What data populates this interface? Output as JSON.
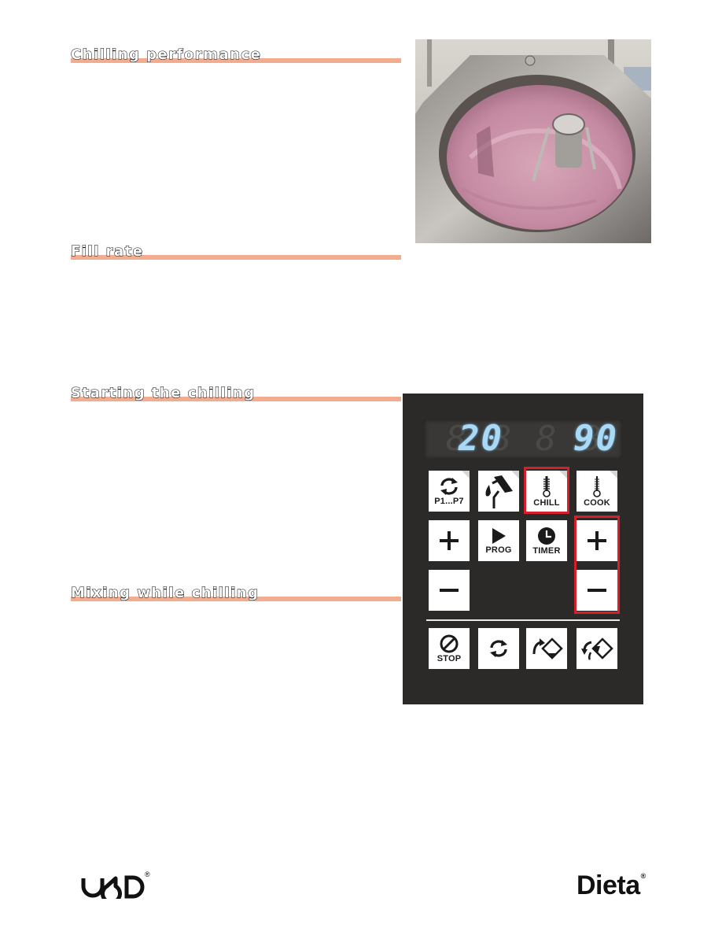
{
  "sections": [
    {
      "id": "chilling-performance",
      "title": "Chilling performance"
    },
    {
      "id": "fill-rate",
      "title": "Fill rate"
    },
    {
      "id": "starting-the-chilling",
      "title": "Starting the chilling"
    },
    {
      "id": "mixing-while-chilling",
      "title": "Mixing while chilling"
    }
  ],
  "colors": {
    "heading_bar": "#f2ad91",
    "highlight": "#d4202a",
    "display_digits": "#a9d9f5",
    "panel": "#2b2a29"
  },
  "photo": {
    "description": "Kettle with pink mixture and mixing tool"
  },
  "control_panel": {
    "display": {
      "left_value": "20",
      "right_value": "90",
      "dim_segments": "8 8 8 8"
    },
    "keys": {
      "programs": {
        "icon": "cycle-arrows-icon",
        "label": "P1...P7"
      },
      "fill": {
        "icon": "water-fill-icon",
        "label": ""
      },
      "chill": {
        "icon": "thermometer-icon",
        "label": "CHILL",
        "highlighted": true
      },
      "cook": {
        "icon": "thermometer-icon",
        "label": "COOK"
      },
      "plus_left": {
        "icon": "plus-icon",
        "label": ""
      },
      "prog": {
        "icon": "play-icon",
        "label": "PROG"
      },
      "timer": {
        "icon": "clock-icon",
        "label": "TIMER"
      },
      "plus_right": {
        "icon": "plus-icon",
        "label": "",
        "highlighted": true
      },
      "minus_left": {
        "icon": "minus-icon",
        "label": ""
      },
      "minus_right": {
        "icon": "minus-icon",
        "label": "",
        "highlighted": true
      },
      "stop": {
        "icon": "stop-icon",
        "label": "STOP"
      },
      "mix": {
        "icon": "cycle-arrows-icon",
        "label": ""
      },
      "tilt_forward": {
        "icon": "tilt-forward-icon",
        "label": ""
      },
      "tilt_back": {
        "icon": "tilt-back-icon",
        "label": ""
      }
    }
  },
  "footer": {
    "logo_left": "DOD",
    "logo_right": "Dieta",
    "registered": "®"
  }
}
